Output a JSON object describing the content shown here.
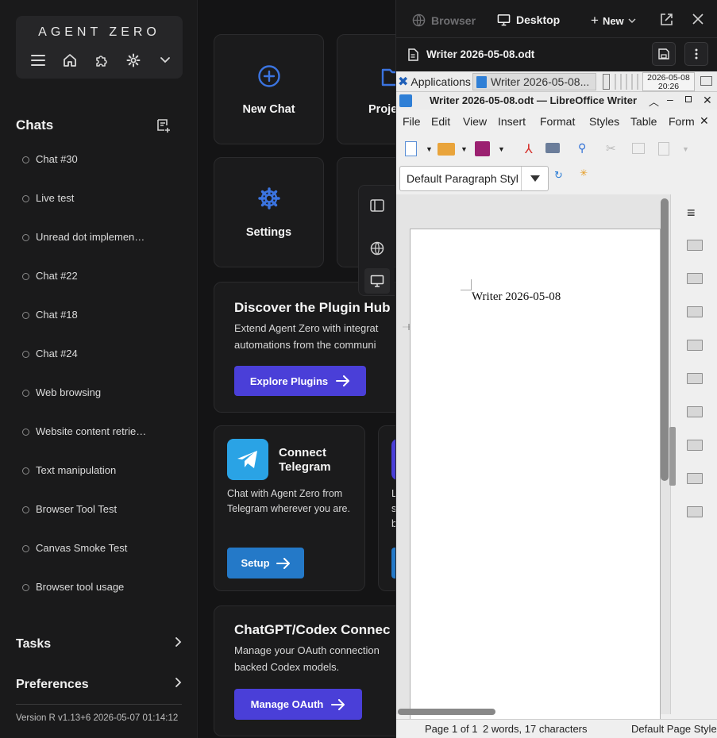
{
  "sidebar": {
    "logo": "AGENT ZERO",
    "chats_heading": "Chats",
    "chats": [
      "Chat #30",
      "Live test",
      "Unread dot implemen…",
      "Chat #22",
      "Chat #18",
      "Chat #24",
      "Web browsing",
      "Website content retrie…",
      "Text manipulation",
      "Browser Tool Test",
      "Canvas Smoke Test",
      "Browser tool usage"
    ],
    "tasks_label": "Tasks",
    "preferences_label": "Preferences",
    "version": "Version R v1.13+6 2026-05-07 01:14:12"
  },
  "main": {
    "tiles": {
      "new_chat": "New Chat",
      "projects": "Proje",
      "settings": "Settings"
    },
    "plugin_hub": {
      "title": "Discover the Plugin Hub",
      "desc": "Extend Agent Zero with integrat automations from the communi",
      "button": "Explore Plugins"
    },
    "telegram": {
      "title": "Connect Telegram",
      "desc": "Chat with Agent Zero from Telegram wherever you are.",
      "button": "Setup",
      "partial_text": "L s b"
    },
    "codex": {
      "title": "ChatGPT/Codex Connec",
      "desc": "Manage your OAuth connection backed Codex models.",
      "button": "Manage OAuth"
    }
  },
  "panel": {
    "tab_browser": "Browser",
    "tab_desktop": "Desktop",
    "new_label": "New",
    "file_name": "Writer 2026-05-08.odt"
  },
  "desktop": {
    "taskbar_apps": "Applications",
    "taskbar_window": "Writer 2026-05-08...",
    "clock_date": "2026-05-08",
    "clock_time": "20:26",
    "window_title": "Writer 2026-05-08.odt — LibreOffice Writer",
    "menu": [
      "File",
      "Edit",
      "View",
      "Insert",
      "Format",
      "Styles",
      "Table",
      "Form"
    ],
    "paragraph_style": "Default Paragraph Styl",
    "document_text": "Writer 2026-05-08",
    "status_page": "Page 1 of 1",
    "status_words": "2 words, 17 characters",
    "status_style": "Default Page Style"
  },
  "colors": {
    "accent_purple": "#4a3fd8",
    "accent_blue": "#2479c8",
    "telegram_blue": "#2aa3e5",
    "icon_blue": "#3b74e0"
  }
}
